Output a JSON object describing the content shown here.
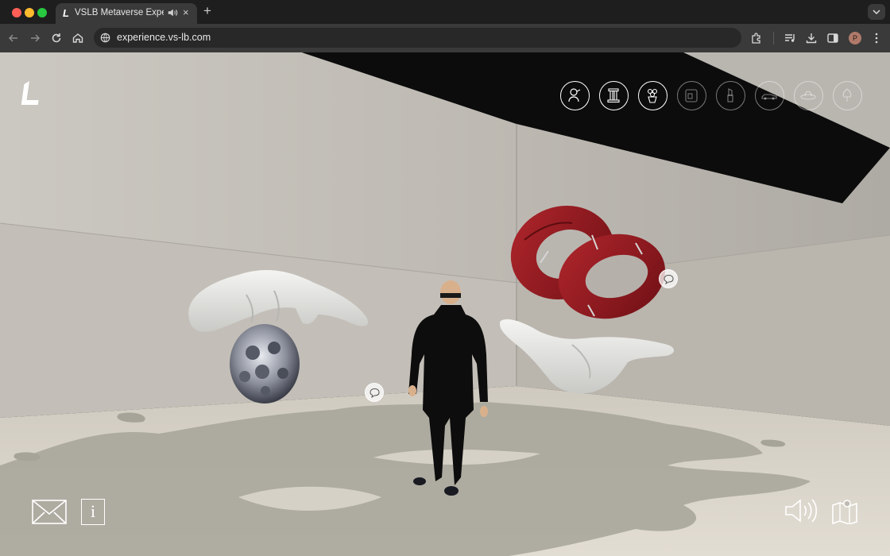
{
  "browser": {
    "tab_title": "VSLB Metaverse Experience",
    "tab_favicon_text": "L",
    "new_tab_symbol": "+",
    "close_symbol": "×",
    "url": "experience.vs-lb.com",
    "profile_initial": "P",
    "colors": {
      "tabbar": "#1e1e1e",
      "toolbar": "#3a3a3a",
      "omnibox": "#282828"
    }
  },
  "toolbar_icons": [
    "back-arrow-icon",
    "forward-arrow-icon",
    "reload-icon",
    "home-icon",
    "site-info-icon",
    "extensions-icon",
    "reading-list-icon",
    "download-icon",
    "side-panel-icon"
  ],
  "experience": {
    "logo_text": "L",
    "collections": [
      {
        "name": "portrait-bust-icon",
        "active": true
      },
      {
        "name": "column-pedestal-icon",
        "active": true
      },
      {
        "name": "flower-bouquet-icon",
        "active": true
      },
      {
        "name": "phone-device-icon",
        "active": false
      },
      {
        "name": "lipstick-icon",
        "active": false
      },
      {
        "name": "sports-car-icon",
        "active": false
      },
      {
        "name": "sun-hat-icon",
        "active": false
      },
      {
        "name": "tree-icon",
        "active": false
      }
    ],
    "bottom_left_buttons": [
      "mail-icon",
      "info-icon"
    ],
    "bottom_right_buttons": [
      "sound-on-icon",
      "map-pin-icon"
    ],
    "info_symbol": "i",
    "hotspots": [
      "hotspot-near-avatar",
      "hotspot-near-ring"
    ],
    "colors": {
      "icon_stroke": "#ffffff",
      "ring": "#8e1a1f",
      "wall": "#c9c6c0",
      "floor": "#d8d3c8"
    }
  }
}
